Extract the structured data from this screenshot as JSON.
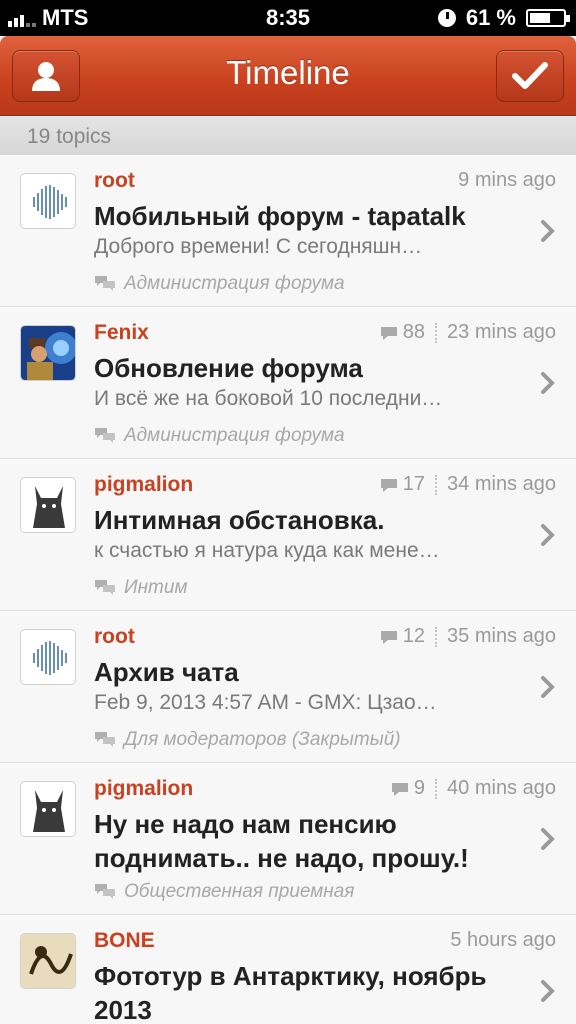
{
  "status_bar": {
    "carrier": "MTS",
    "time": "8:35",
    "battery": "61 %",
    "battery_level": 0.61
  },
  "nav": {
    "title": "Timeline",
    "left_icon": "user-icon",
    "right_icon": "checkmark-icon"
  },
  "section": {
    "label": "19 topics"
  },
  "colors": {
    "accent": "#c9411f",
    "nav_bar": "#c8401e"
  },
  "topics": [
    {
      "author": "root",
      "replies": "",
      "time": "9 mins ago",
      "title": "Мобильный форум - tapatalk",
      "preview": "Доброго времени!   С сегодняшн…",
      "forum": "Администрация форума",
      "avatar": "bars"
    },
    {
      "author": "Fenix",
      "replies": "88",
      "time": "23 mins ago",
      "title": "Обновление форума",
      "preview": "И всё же на боковой 10 последни…",
      "forum": "Администрация форума",
      "avatar": "photo"
    },
    {
      "author": "pigmalion",
      "replies": "17",
      "time": "34 mins ago",
      "title": "Интимная обстановка.",
      "preview": "к счастью я натура куда как мене…",
      "forum": "Интим",
      "avatar": "wolf"
    },
    {
      "author": "root",
      "replies": "12",
      "time": "35 mins ago",
      "title": "Архив чата",
      "preview": "Feb 9, 2013 4:57 AM - GMX: Цзао…",
      "forum": "Для модераторов (Закрытый)",
      "avatar": "bars"
    },
    {
      "author": "pigmalion",
      "replies": "9",
      "time": "40 mins ago",
      "title": "Ну не надо нам пенсию поднимать.. не надо, прошу.!",
      "preview": "",
      "forum": "Общественная приемная",
      "avatar": "wolf"
    },
    {
      "author": "BONE",
      "replies": "",
      "time": "5 hours ago",
      "title": "Фототур в Антарктику, ноябрь 2013",
      "preview": "",
      "forum": "",
      "avatar": "sketch"
    }
  ]
}
